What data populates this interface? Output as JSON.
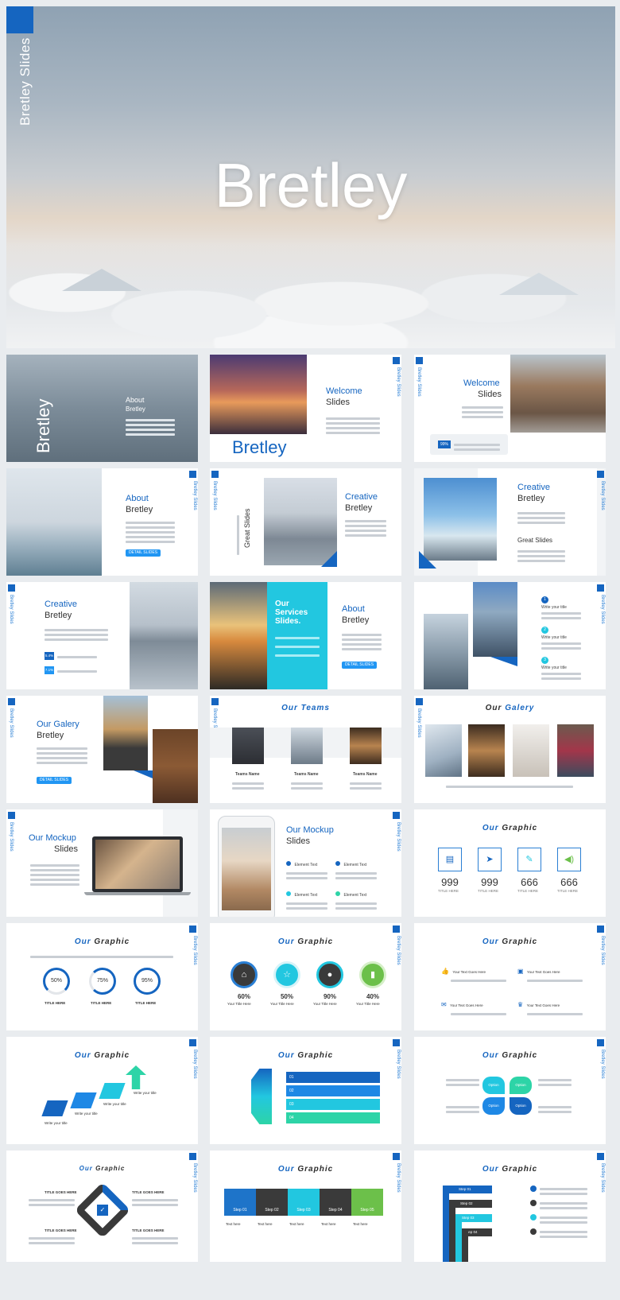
{
  "hero": {
    "brand": "Bretley Slides",
    "title": "Bretley"
  },
  "side_label": "Bretley Slides",
  "labels": {
    "bretley": "Bretley",
    "slides": "Slides",
    "about": "About",
    "welcome": "Welcome",
    "creative": "Creative",
    "great_slides": "Great Slides",
    "detail_slides": "DETAIL SLIDES",
    "our_services": "Our Services Slides.",
    "our_galery": "Our Galery",
    "our_teams": "Our Teams",
    "our_mockup": "Our Mockup",
    "our": "Our",
    "graphic": "Graphic",
    "write_your_title": "Write your title",
    "team_name": "Teams Name",
    "title_here": "TITLE HERE",
    "title_here_mixed": "Title Here",
    "your_title_here": "Your Title Here",
    "element_text": "Element Text",
    "your_text_goes_here": "Your Text Goes Here",
    "text_here": "Text here",
    "title_goes_here": "TITLE GOES HERE",
    "option": "Option",
    "pct_99": "99%",
    "pct_54": "5.4%",
    "pct_71": "7.1%"
  },
  "counters": [
    "999",
    "999",
    "666",
    "666"
  ],
  "progress_rings": [
    {
      "label": "50%",
      "value": 0.5
    },
    {
      "label": "75%",
      "value": 0.75
    },
    {
      "label": "95%",
      "value": 0.95
    }
  ],
  "stat_circles": [
    {
      "label": "60%",
      "color": "#3a3a3a"
    },
    {
      "label": "50%",
      "color": "#22c7e0"
    },
    {
      "label": "90%",
      "color": "#3a3a3a"
    },
    {
      "label": "40%",
      "color": "#6cc04a"
    }
  ],
  "steps": [
    {
      "label": "Step 01",
      "color": "#1e74c9"
    },
    {
      "label": "Step 02",
      "color": "#3a3a3a"
    },
    {
      "label": "Step 03",
      "color": "#22c7e0"
    },
    {
      "label": "Step 04",
      "color": "#3a3a3a"
    },
    {
      "label": "Step 05",
      "color": "#6cc04a"
    }
  ],
  "list_numbers": [
    "01",
    "02",
    "03",
    "04"
  ],
  "numbered": [
    "1",
    "2",
    "3"
  ],
  "colors": {
    "accent": "#1565c0",
    "cyan": "#22c7e0",
    "green": "#6cc04a",
    "dark": "#3a3a3a"
  }
}
